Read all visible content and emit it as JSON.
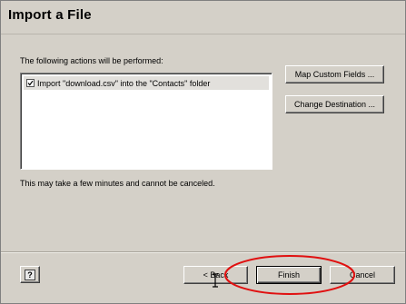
{
  "window": {
    "title": "Import a File"
  },
  "actions": {
    "label": "The following actions will be performed:",
    "items": [
      {
        "checked": true,
        "text": "Import \"download.csv\" into the \"Contacts\" folder"
      }
    ]
  },
  "side_buttons": {
    "map_custom_fields": "Map Custom Fields ...",
    "change_destination": "Change Destination ..."
  },
  "note": "This may take a few minutes and cannot be canceled.",
  "footer": {
    "help_icon": "help-icon",
    "help_glyph": "?",
    "back_label": "< Back",
    "finish_label": "Finish",
    "cancel_label": "Cancel"
  },
  "colors": {
    "dialog_bg": "#d4d0c8",
    "highlight_ellipse": "#e01010"
  }
}
